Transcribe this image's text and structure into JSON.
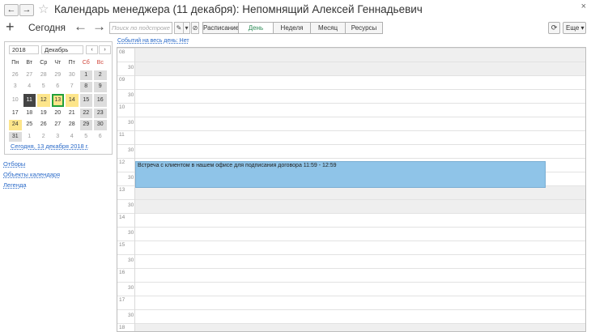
{
  "window": {
    "title": "Календарь менеджера (11 декабря): Непомнящий Алексей Геннадьевич",
    "close_label": "×"
  },
  "toolbar": {
    "create_label": "+",
    "today_label": "Сегодня",
    "back_arrow": "←",
    "forward_arrow": "→",
    "search_placeholder": "Поиск по подстроке",
    "views": [
      "Расписание",
      "День",
      "Неделя",
      "Месяц",
      "Ресурсы"
    ],
    "active_view": "День",
    "refresh_icon": "⟳",
    "more_label": "Еще"
  },
  "mini_calendar": {
    "year": "2018",
    "month": "Декабрь",
    "prev": "‹",
    "next": "›",
    "weekdays": [
      "Пн",
      "Вт",
      "Ср",
      "Чт",
      "Пт",
      "Сб",
      "Вс"
    ],
    "weeks": [
      [
        "26",
        "27",
        "28",
        "29",
        "30",
        "1",
        "2"
      ],
      [
        "3",
        "4",
        "5",
        "6",
        "7",
        "8",
        "9"
      ],
      [
        "10",
        "11",
        "12",
        "13",
        "14",
        "15",
        "16"
      ],
      [
        "17",
        "18",
        "19",
        "20",
        "21",
        "22",
        "23"
      ],
      [
        "24",
        "25",
        "26",
        "27",
        "28",
        "29",
        "30"
      ],
      [
        "31",
        "1",
        "2",
        "3",
        "4",
        "5",
        "6"
      ]
    ],
    "today_link": "Сегодня, 13 декабря 2018 г."
  },
  "left_links": [
    "Отборы",
    "Объекты календаря",
    "Легенда"
  ],
  "all_day_events_label": "Событий на весь день: Нет",
  "day_view": {
    "hours": [
      "08",
      "09",
      "10",
      "11",
      "12",
      "13",
      "14",
      "15",
      "16",
      "17",
      "18"
    ],
    "half_label": "30"
  },
  "event": {
    "text": "Встреча с клиентом в нашем офисе для подписания договора 11:59 - 12:59"
  },
  "colors": {
    "event": "#8fc4e8",
    "highlight_yellow": "#fde58a",
    "selected_day": "#444444",
    "today_border": "#22a03a",
    "link": "#2a6ac8",
    "active_view_text": "#2e8b57"
  }
}
